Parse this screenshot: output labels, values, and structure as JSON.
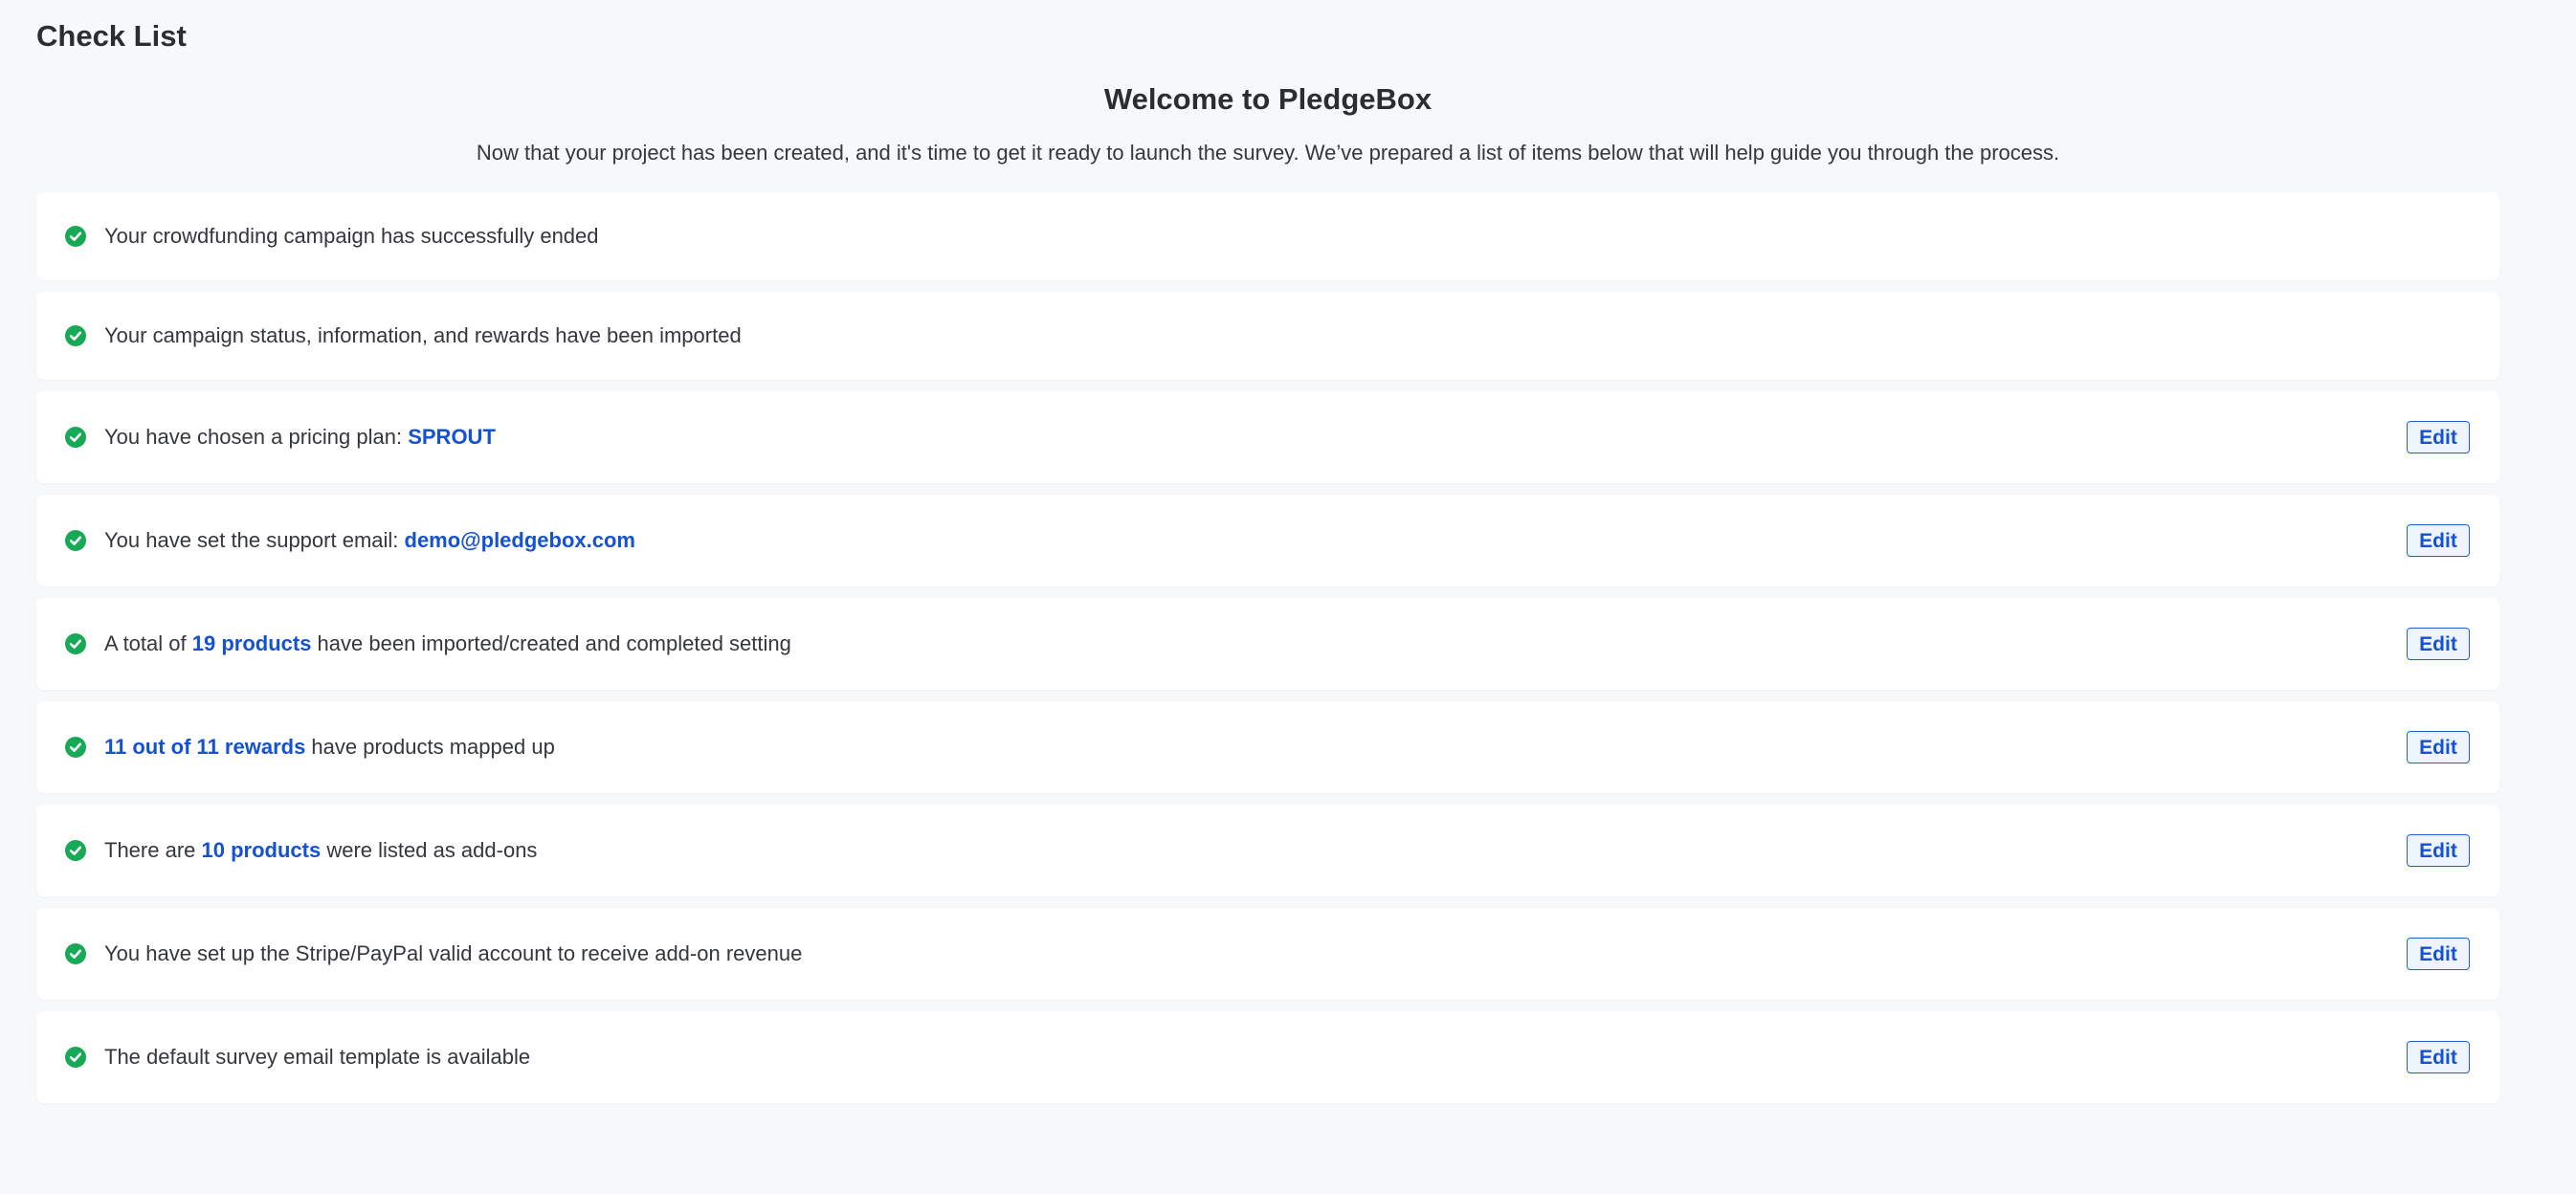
{
  "page": {
    "title": "Check List",
    "welcome_title": "Welcome to PledgeBox",
    "intro": "Now that your project has been created, and it's time to get it ready to launch the survey. We’ve prepared a list of items below that will help guide you through the process."
  },
  "checklist": {
    "edit_label": "Edit",
    "icon": "check-circle-icon",
    "check_color": "#18a957",
    "highlight_color": "#1552d2",
    "items": [
      {
        "pre": "Your crowdfunding campaign has successfully ended",
        "hl": "",
        "post": ""
      },
      {
        "pre": "Your campaign status, information, and rewards have been imported",
        "hl": "",
        "post": ""
      },
      {
        "pre": "You have chosen a pricing plan: ",
        "hl": "SPROUT",
        "post": ""
      },
      {
        "pre": "You have set the support email: ",
        "hl": "demo@pledgebox.com",
        "post": ""
      },
      {
        "pre": "A total of ",
        "hl": "19 products",
        "post": " have been imported/created and completed setting"
      },
      {
        "pre": "",
        "hl": "11 out of 11 rewards",
        "post": " have products mapped up"
      },
      {
        "pre": "There are ",
        "hl": "10 products",
        "post": " were listed as add-ons"
      },
      {
        "pre": "You have set up the Stripe/PayPal valid account to receive add-on revenue",
        "hl": "",
        "post": ""
      },
      {
        "pre": "The default survey email template is available",
        "hl": "",
        "post": ""
      }
    ]
  }
}
